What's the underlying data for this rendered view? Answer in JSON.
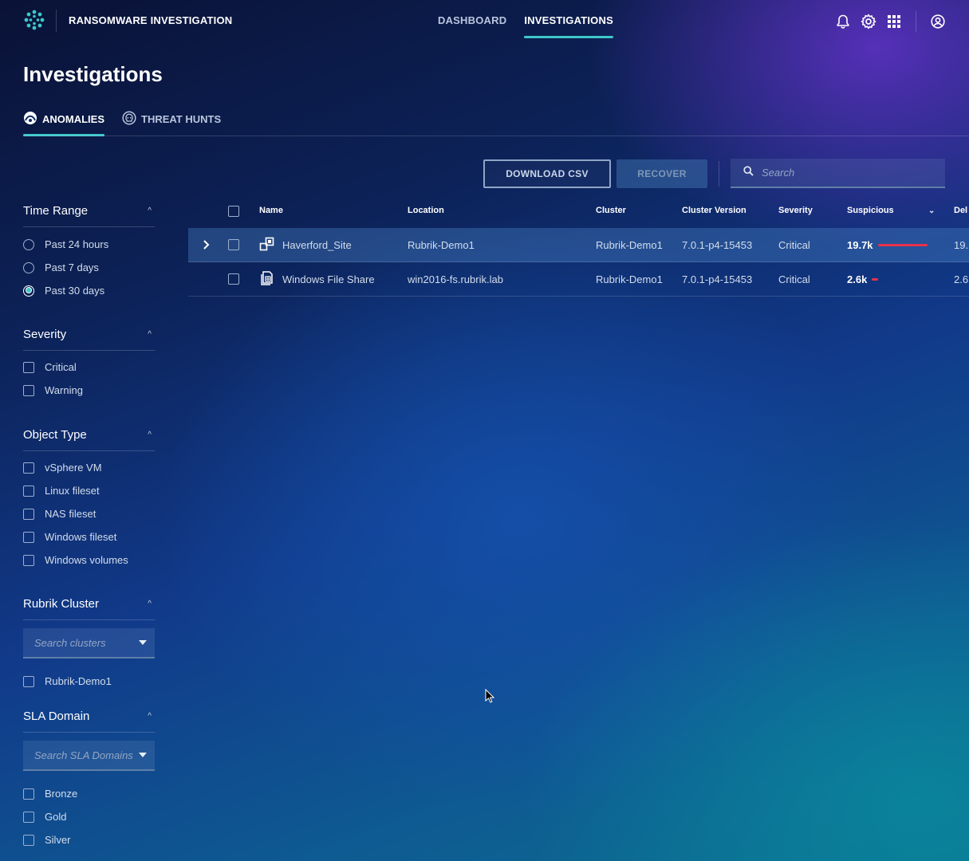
{
  "header": {
    "app_title": "RANSOMWARE INVESTIGATION",
    "nav": [
      {
        "label": "DASHBOARD",
        "active": false
      },
      {
        "label": "INVESTIGATIONS",
        "active": true
      }
    ],
    "icons": [
      "bell-icon",
      "gear-icon",
      "apps-grid-icon",
      "user-account-icon"
    ]
  },
  "page": {
    "title": "Investigations",
    "tabs": [
      {
        "label": "ANOMALIES",
        "icon": "anomalies-icon",
        "active": true
      },
      {
        "label": "THREAT HUNTS",
        "icon": "skull-icon",
        "active": false
      }
    ]
  },
  "toolbar": {
    "download_label": "DOWNLOAD CSV",
    "recover_label": "RECOVER",
    "search_placeholder": "Search"
  },
  "filters": {
    "time_range": {
      "title": "Time Range",
      "options": [
        {
          "label": "Past 24 hours",
          "selected": false
        },
        {
          "label": "Past 7 days",
          "selected": false
        },
        {
          "label": "Past 30 days",
          "selected": true
        }
      ]
    },
    "severity": {
      "title": "Severity",
      "options": [
        {
          "label": "Critical"
        },
        {
          "label": "Warning"
        }
      ]
    },
    "object_type": {
      "title": "Object Type",
      "options": [
        {
          "label": "vSphere VM"
        },
        {
          "label": "Linux fileset"
        },
        {
          "label": "NAS fileset"
        },
        {
          "label": "Windows fileset"
        },
        {
          "label": "Windows volumes"
        }
      ]
    },
    "rubrik_cluster": {
      "title": "Rubrik Cluster",
      "search_placeholder": "Search clusters",
      "options": [
        {
          "label": "Rubrik-Demo1"
        }
      ]
    },
    "sla_domain": {
      "title": "SLA Domain",
      "search_placeholder": "Search SLA Domains",
      "options": [
        {
          "label": "Bronze"
        },
        {
          "label": "Gold"
        },
        {
          "label": "Silver"
        }
      ]
    }
  },
  "table": {
    "columns": {
      "name": "Name",
      "location": "Location",
      "cluster": "Cluster",
      "cluster_version": "Cluster Version",
      "severity": "Severity",
      "suspicious": "Suspicious",
      "deleted": "Del"
    },
    "rows": [
      {
        "name": "Haverford_Site",
        "icon": "vm-icon",
        "location": "Rubrik-Demo1",
        "cluster": "Rubrik-Demo1",
        "cluster_version": "7.0.1-p4-15453",
        "severity": "Critical",
        "suspicious": "19.7k",
        "suspicious_fraction": 1.0,
        "deleted": "19.",
        "selected": true,
        "expandable": true
      },
      {
        "name": "Windows File Share",
        "icon": "file-share-icon",
        "location": "win2016-fs.rubrik.lab",
        "cluster": "Rubrik-Demo1",
        "cluster_version": "7.0.1-p4-15453",
        "severity": "Critical",
        "suspicious": "2.6k",
        "suspicious_fraction": 0.13,
        "deleted": "2.6",
        "selected": false,
        "expandable": false
      }
    ]
  },
  "colors": {
    "accent": "#3ec7c9",
    "critical_bar": "#e8314a"
  }
}
